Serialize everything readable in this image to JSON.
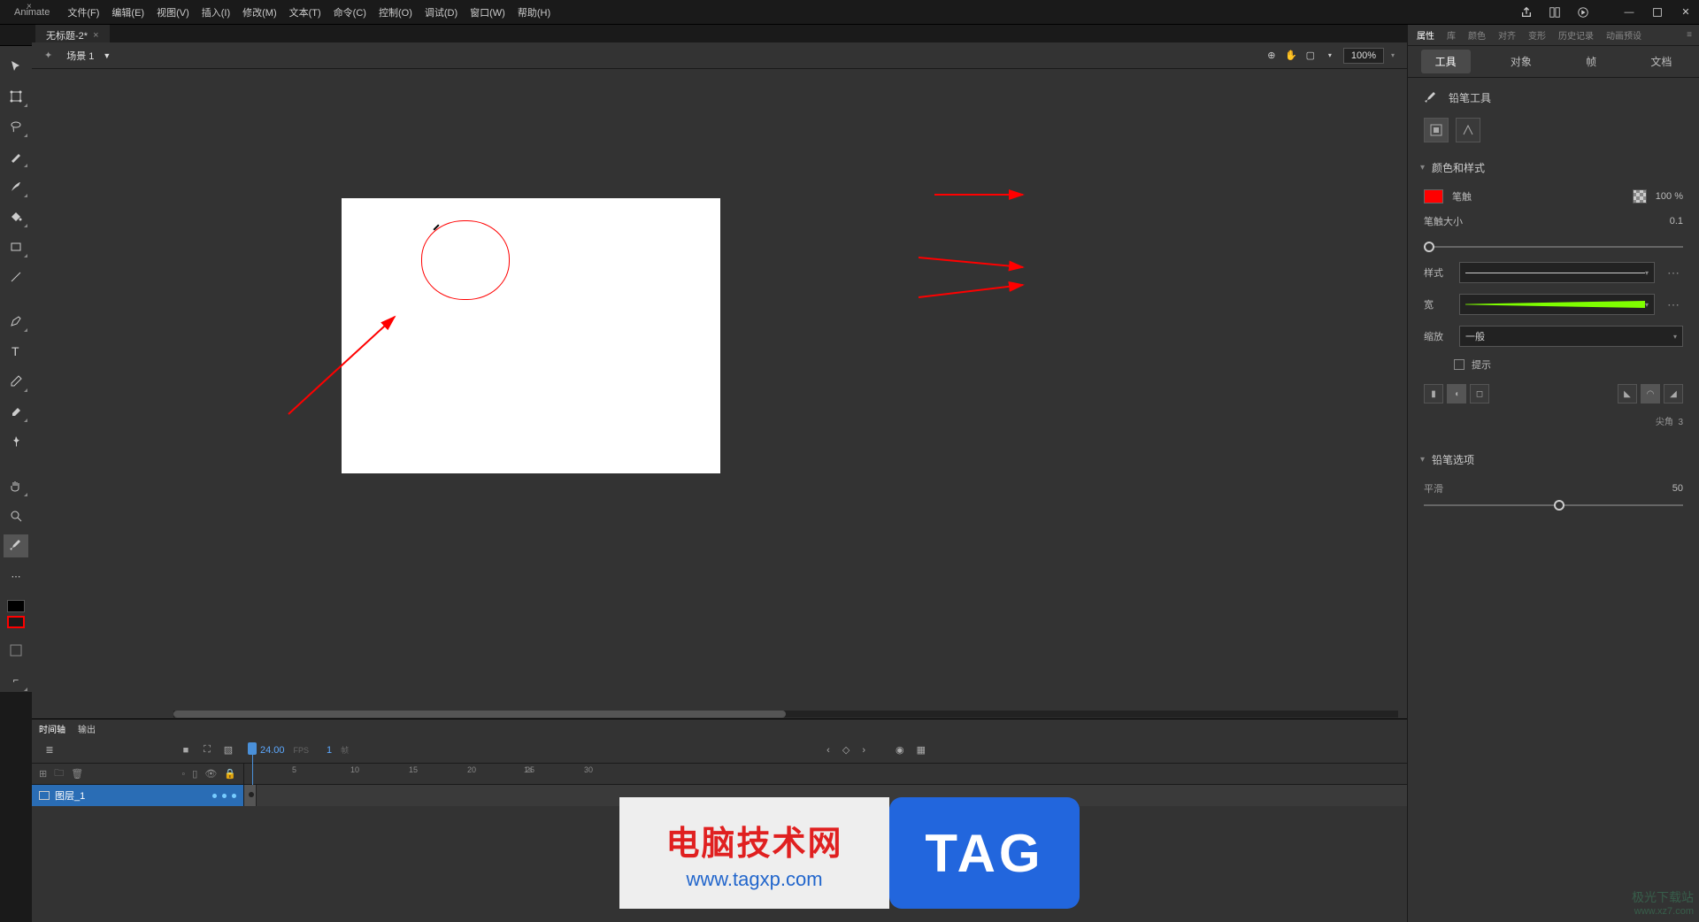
{
  "app": {
    "title": "Animate"
  },
  "menu": {
    "file": "文件(F)",
    "edit": "编辑(E)",
    "view": "视图(V)",
    "insert": "插入(I)",
    "modify": "修改(M)",
    "text": "文本(T)",
    "command": "命令(C)",
    "control": "控制(O)",
    "debug": "调试(D)",
    "window": "窗口(W)",
    "help": "帮助(H)"
  },
  "document": {
    "tab_name": "无标题-2*"
  },
  "scene": {
    "name": "场景 1",
    "zoom": "100%"
  },
  "panel_tabs": {
    "properties": "属性",
    "library": "库",
    "color": "颜色",
    "align": "对齐",
    "transform": "变形",
    "history": "历史记录",
    "anim_preset": "动画预设"
  },
  "sub_tabs": {
    "tool": "工具",
    "object": "对象",
    "frame": "帧",
    "document": "文档"
  },
  "tool": {
    "name": "铅笔工具"
  },
  "section": {
    "color_style": "颜色和样式",
    "pencil_options": "铅笔选项"
  },
  "props": {
    "stroke_label": "笔触",
    "stroke_alpha": "100 %",
    "stroke_size_label": "笔触大小",
    "stroke_size_val": "0.1",
    "style_label": "样式",
    "width_label": "宽",
    "scale_label": "缩放",
    "scale_val": "一般",
    "hint_label": "提示",
    "corner_label": "尖角",
    "corner_val": "3",
    "smooth_label": "平滑",
    "smooth_val": "50"
  },
  "colors": {
    "stroke": "#ff0000"
  },
  "timeline": {
    "tab_timeline": "时间轴",
    "tab_output": "输出",
    "fps": "24.00",
    "fps_label": "FPS",
    "frame": "1",
    "frame_label": "帧",
    "layer_name": "图层_1",
    "ruler_marks": [
      "1s",
      "5",
      "10",
      "15",
      "20",
      "25",
      "30"
    ],
    "ruler_label_1s": "1s"
  },
  "watermark": {
    "line1": "电脑技术网",
    "line2": "www.tagxp.com",
    "tag": "TAG",
    "corner1": "极光下载站",
    "corner2": "www.xz7.com"
  }
}
